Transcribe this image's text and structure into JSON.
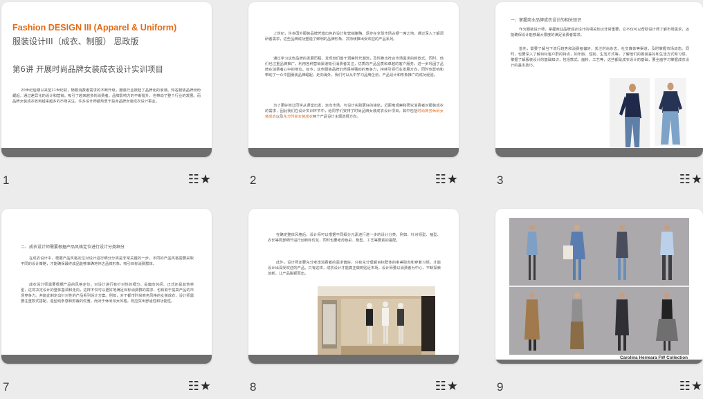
{
  "actions_icon": "slide-options-star-icon",
  "actions_glyph": "☷★",
  "slides": {
    "s1": {
      "number": "1",
      "title": "Fashion DESIGN III (Apparel & Uniform)",
      "subtitle": "服装设计III（成衣、制服） 思政版",
      "lecture": "第6讲 开展时尚品牌女装成衣设计实训项目",
      "body": "20世纪后期以来至21世纪初，随着消费者需求的不断升级，服装行业掀起了品牌化的浪潮。知名服装品牌纷纷崛起，通过差异化的设计和营销，吸引了越来越多的消费者。品牌影响力的不断提升，也带动了整个行业的发展。而品牌女装成衣收到越来越多的市场关注，许多设计师都热衷于投身品牌女装成衣设计事业。"
    },
    "s2": {
      "number": "2",
      "p1": "上世纪，许多国外服装品牌凭借出色的设计和营销策略，逐步在全球市场占据一席之地。通过深入了解调研者需求，这些品牌成功塑造了鲜明的品牌形象，并持续推出受欢迎的产品系列。",
      "p2": "通过学习这些品牌的发展历程，发现他们善于洞察时代潮流，及时推出符合市场需求的新款式。同时，他们也注重品牌推广，利用各种营销渠道吸引消费者关注，优质的产品品质和卓越的客户服务，进一步巩固了品牌在消费者心中的地位。如今，这些服装品牌仍然保持强劲的竞争力，持续引领行业发展方向，同时也影响和带动了一众中国服装品牌崛起，走向海外，我们可以从中学习品牌企划、产品设计和形象推广的成功经验。",
      "p3_before": "为了更好地让同学从课堂出发，走向市场，与设计实践更好的接轨，近距离观察和研究消费者对服装成衣的需求，因此我们在设计实训环节中，给同学们安排了时尚品牌女装成衣设计项目，其中包括",
      "p3_hl1": "时尚商务休闲女装成衣",
      "p3_mid": "以及",
      "p3_hl2": "东方时尚女装成衣",
      "p3_after": "两个产品设计主题选择方向。"
    },
    "s3": {
      "number": "3",
      "heading": "一、掌握商业品牌成衣设计的相关知识",
      "p1": "作为服装设计师，掌握商业品牌成衣设计的相关知识非常重要，它不仅可以帮助设计师了解市场需求，还能确保设计能够最大限度的满足消费者需求。",
      "p2": "首先，需要了解当下流行趋势和消费者偏好，关注时尚杂志、社交媒体等渠道，及时掌握市场动态。同时，也要深入了解目标客户群的特点，如年龄、性别、生活方式等，了解他们的着装喜好和生活方式和习惯，掌握了解服装设计的基础知识，包括款式、面料、工艺等，这些都是成衣设计的基础，要全面学习掌握成衣设计的基本技巧。"
    },
    "s7": {
      "number": "7",
      "heading": "二、成衣设计师需要根据产品风格定位进行设计分类细分",
      "p1": "在成衣设计中，根据产品风格定位对设计进行细分分类是非常关键的一步。不同的产品风格需要采取不同的设计策略，才能确保最终成品能够准确地传达品牌形象，吸引目标消费群体。",
      "p2": "成衣设计师需要根据产品的风格定位，对设计进行有针对性的细分。是偏向休闲、正式还是其他类型，这将决定设计的整体基调和走向，这样不仅可以更好地满足目标消费群的需求，也有助于提高产品的市场竞争力。并能此制定出针对性的产品系列设计方案。例如，对于都市时尚商务风格的女装成衣，设计师需要注重款式搭配、造型线条感和剪裁的优雅，而对于休闲派女风格，则应突出舒适性和功能性。"
    },
    "s8": {
      "number": "8",
      "p1": "在确定整体风格后，设计师可以根据不同细分元素进行进一步的设计分类。例如，针对领型、袖型、衣长等局部细节进行创新和优化，同时也要考虑色彩、板型、工艺等要素的搭配。",
      "p2": "此外，设计师还要充分考虑消费者的需求偏好，只有充分理解目标群体的审美取向和穿着习惯，才能设计出深受欢迎的产品。只有这样，成衣设计才能真正做到贴近市场，设计师要以消费者为中心，不断探索创新，让产品脱颖而出。"
    },
    "s9": {
      "number": "9",
      "caption": "Carolina Herreara FW Collection"
    }
  }
}
